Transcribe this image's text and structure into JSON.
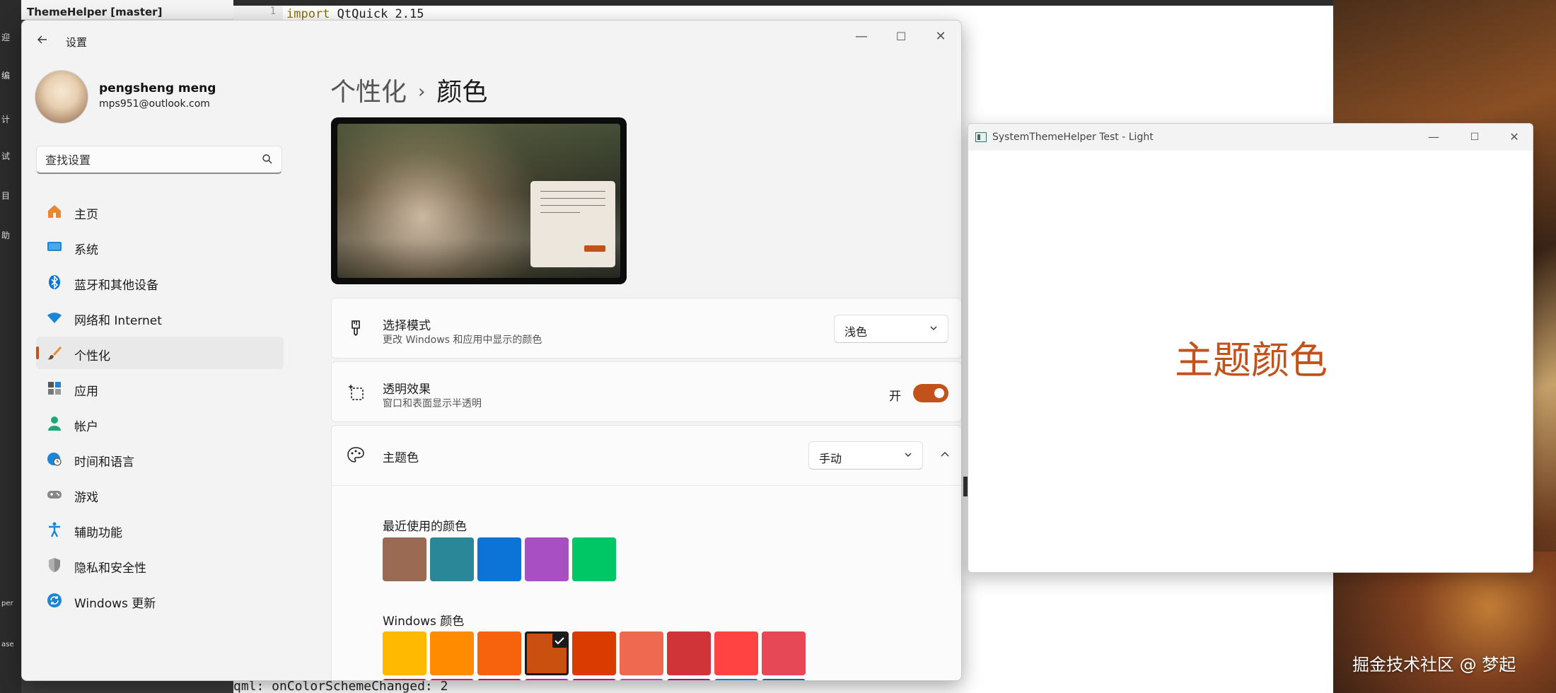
{
  "ide": {
    "tree_item": "ThemeHelper [master]",
    "line_number": "1",
    "code_keyword": "import",
    "code_rest": " QtQuick 2.15",
    "console_line": "qml: onColorSchemeChanged: 2",
    "left_glyphs": [
      "迎",
      "编",
      "计",
      "试",
      "目",
      "助",
      "per",
      "ase"
    ]
  },
  "watermark": "掘金技术社区 @ 梦起",
  "settings": {
    "title": "设置",
    "window_controls": [
      "—",
      "☐",
      "✕"
    ],
    "profile": {
      "name": "pengsheng meng",
      "email": "mps951@outlook.com"
    },
    "search": {
      "placeholder": "查找设置"
    },
    "nav": [
      {
        "label": "主页",
        "icon": "home-icon"
      },
      {
        "label": "系统",
        "icon": "monitor-icon"
      },
      {
        "label": "蓝牙和其他设备",
        "icon": "bluetooth-icon"
      },
      {
        "label": "网络和 Internet",
        "icon": "wifi-icon"
      },
      {
        "label": "个性化",
        "icon": "brush-icon"
      },
      {
        "label": "应用",
        "icon": "apps-icon"
      },
      {
        "label": "帐户",
        "icon": "person-icon"
      },
      {
        "label": "时间和语言",
        "icon": "globe-clock-icon"
      },
      {
        "label": "游戏",
        "icon": "gamepad-icon"
      },
      {
        "label": "辅助功能",
        "icon": "accessibility-icon"
      },
      {
        "label": "隐私和安全性",
        "icon": "shield-icon"
      },
      {
        "label": "Windows 更新",
        "icon": "refresh-icon"
      }
    ],
    "active_nav": "个性化",
    "breadcrumb": {
      "parent": "个性化",
      "separator": "›",
      "current": "颜色"
    },
    "mode_card": {
      "title": "选择模式",
      "description": "更改 Windows 和应用中显示的颜色",
      "value": "浅色"
    },
    "transparency_card": {
      "title": "透明效果",
      "description": "窗口和表面显示半透明",
      "toggle_label": "开",
      "toggle_on": true
    },
    "accent_card": {
      "title": "主题色",
      "value": "手动"
    },
    "recent_label": "最近使用的颜色",
    "recent_colors": [
      "#9a6b52",
      "#2a8798",
      "#0b74d6",
      "#a94fc4",
      "#00c766"
    ],
    "windows_label": "Windows 颜色",
    "windows_colors_row1": [
      "#ffb900",
      "#ff8c00",
      "#f7630c",
      "#ca5010",
      "#da3b01",
      "#ef6950",
      "#d13438",
      "#ff4343",
      "#e74856"
    ],
    "windows_colors_row2": [
      "#e81123",
      "#ea005e",
      "#c30052",
      "#e3008c",
      "#bf0077",
      "#c239b3",
      "#9a0089",
      "#0078d7",
      "#0063b1"
    ],
    "selected_color": "#ca5010"
  },
  "test_window": {
    "title": "SystemThemeHelper Test - Light",
    "window_controls": [
      "—",
      "☐",
      "✕"
    ],
    "text": "主题颜色",
    "text_color": "#c2521a"
  },
  "accent_color": "#c2521a"
}
